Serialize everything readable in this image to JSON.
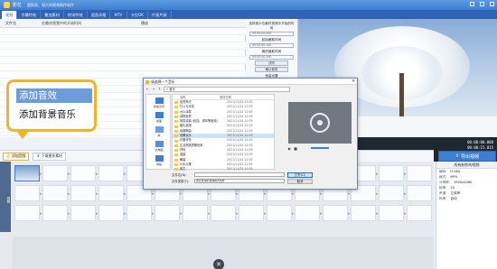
{
  "app": {
    "name": "影忆",
    "slogan": "超简易、强大的视频制作软件"
  },
  "menu_tabs": [
    "视频",
    "字幕特效",
    "叠加素材",
    "转场特效",
    "画面风格",
    "MTV",
    "卡拉OK",
    "片尾片接"
  ],
  "list_headers": [
    "文件名",
    "在最终视频中的开始时间",
    "播放"
  ],
  "settings": {
    "time_label": "选择音乐在最终视频中开始的时间",
    "start_label": "起始截取时间",
    "end_label": "最终截取时间",
    "time_value": "00:00:00.000",
    "preview_btn": "试听",
    "confirm_btn": "确认修改",
    "volume_label": "音量设置",
    "fade_in": "头尾声音淡入淡出"
  },
  "preview": {
    "time_current": "00:00:00.000",
    "time_total": "00:00:15.015"
  },
  "export_label": "导出视频",
  "toolbar": {
    "add_audio": "添加音频",
    "bgm": "下载更多素材"
  },
  "callout": {
    "item1": "添加音效",
    "item2": "添加背景音乐"
  },
  "dialog": {
    "title": "请选择一个音乐",
    "path": "« 音乐",
    "sidebar": [
      "快速访问",
      "桌面",
      "库",
      "此电脑",
      "网络"
    ],
    "columns": [
      "名称",
      "修改日期"
    ],
    "files": [
      {
        "name": "自然风光",
        "date": "2021/11/24 12:05"
      },
      {
        "name": "打斗与冲突",
        "date": "2021/11/24 12:05"
      },
      {
        "name": "大片浑厚",
        "date": "2021/11/24 12:05"
      },
      {
        "name": "动物世界",
        "date": "2021/11/24 12:05"
      },
      {
        "name": "搞笑诙谐 (包括、诱拿等音效)",
        "date": "2021/11/24 12:05"
      },
      {
        "name": "婚礼浪漫",
        "date": "2021/11/24 12:05"
      },
      {
        "name": "经典歌曲",
        "date": "2021/11/24 12:05"
      },
      {
        "name": "欢腾欢乐",
        "date": "2021/11/24 12:05"
      },
      {
        "name": "可爱可怜",
        "date": "2021/11/24 12:05"
      },
      {
        "name": "生活搞笑舒服世家",
        "date": "2021/11/24 12:05"
      },
      {
        "name": "抒情",
        "date": "2021/11/24 12:05"
      },
      {
        "name": "温馨",
        "date": "2021/11/24 12:05"
      },
      {
        "name": "舞曲",
        "date": "2021/11/24 12:05"
      },
      {
        "name": "片头片尾",
        "date": "2021/11/24 12:05"
      },
      {
        "name": "其它",
        "date": "2021/11/24 12:05"
      }
    ],
    "filename_label": "文件名(N):",
    "filetype_label": "文件类型(T):",
    "filetype_value": "所有支持的音频格式文件",
    "open_btn": "打开(O)",
    "cancel_btn": "取消"
  },
  "timeline": {
    "track_label": "视频"
  },
  "info": {
    "title": "所有制作的视频",
    "rows": [
      [
        "编码:",
        "H.264"
      ],
      [
        "格式:",
        "MP4"
      ],
      [
        "分辨率:",
        "1920x1080"
      ],
      [
        "帧率:",
        "25"
      ],
      [
        "声道:",
        "立体声"
      ],
      [
        "码率:",
        "自动"
      ]
    ]
  }
}
